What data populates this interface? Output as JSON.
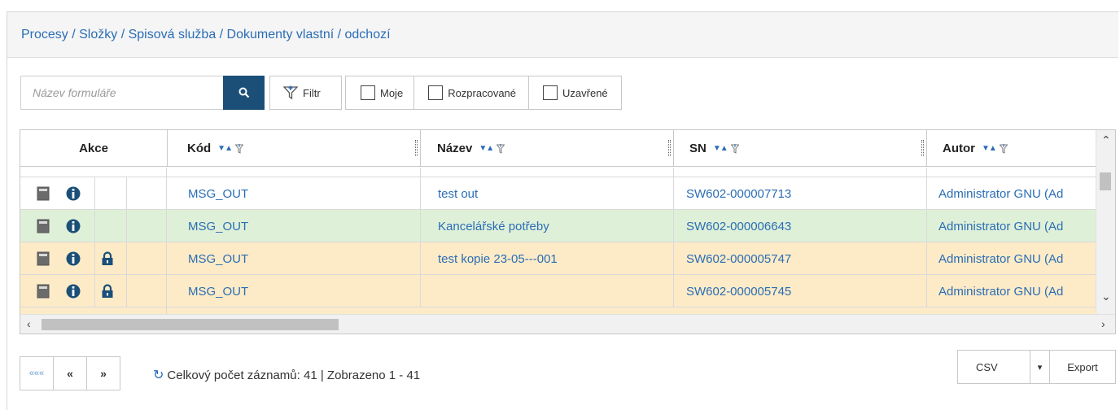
{
  "breadcrumb": "Procesy / Složky / Spisová služba / Dokumenty vlastní / odchozí",
  "search": {
    "placeholder": "Název formuláře"
  },
  "toolbar": {
    "filter_label": "Filtr"
  },
  "checkboxes": [
    {
      "label": "Moje",
      "checked": false
    },
    {
      "label": "Rozpracované",
      "checked": false
    },
    {
      "label": "Uzavřené",
      "checked": false
    }
  ],
  "grid": {
    "columns": [
      "Akce",
      "Kód",
      "Název",
      "SN",
      "Autor"
    ],
    "rows": [
      {
        "kod": "MSG_OUT",
        "nazev": "test out",
        "sn": "SW602-000007713",
        "autor": "Administrator GNU (Ad",
        "lock": false,
        "color": "white"
      },
      {
        "kod": "MSG_OUT",
        "nazev": "Kancelářské potřeby",
        "sn": "SW602-000006643",
        "autor": "Administrator GNU (Ad",
        "lock": false,
        "color": "green"
      },
      {
        "kod": "MSG_OUT",
        "nazev": "test kopie 23-05---001",
        "sn": "SW602-000005747",
        "autor": "Administrator GNU (Ad",
        "lock": true,
        "color": "orange"
      },
      {
        "kod": "MSG_OUT",
        "nazev": "",
        "sn": "SW602-000005745",
        "autor": "Administrator GNU (Ad",
        "lock": true,
        "color": "orange"
      }
    ]
  },
  "pager": {
    "first": "«««",
    "prev": "«",
    "next": "»"
  },
  "footer": {
    "count_text": "Celkový počet záznamů: 41 | Zobrazeno 1 - 41"
  },
  "export": {
    "format": "CSV",
    "button": "Export"
  },
  "colors": {
    "link": "#2a6db5",
    "search_button": "#1b4f78",
    "row_green": "#dff0d8",
    "row_orange": "#fdebc7"
  }
}
